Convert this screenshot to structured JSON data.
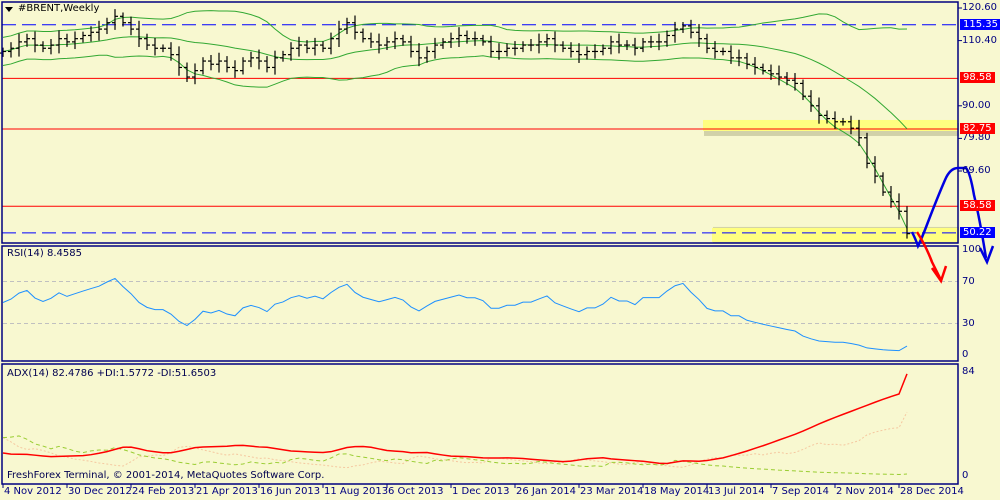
{
  "header": {
    "title": "#BRENT,Weekly",
    "menu_icon": "triangle-down-icon"
  },
  "indicators": {
    "rsi_label": "RSI(14) 8.4585",
    "adx_label": "ADX(14) 82.4786 +DI:1.5772 -DI:51.6503"
  },
  "footer": {
    "copyright": "FreshForex Terminal, © 2001-2014, MetaQuotes Software Corp."
  },
  "colors": {
    "background": "#f8f8d0",
    "axis": "#000080",
    "bands": "#32a832",
    "red_level": "#ff0000",
    "blue_level": "#0000ff",
    "zone": "#ffff80",
    "rsi": "#1e90ff",
    "adx": "#ff0000",
    "plus_di": "#9acd32",
    "minus_di": "#f5c8a0"
  },
  "chart_data": {
    "type": "bar",
    "title": "#BRENT,Weekly",
    "x_labels": [
      "4 Nov 2012",
      "30 Dec 2012",
      "24 Feb 2013",
      "21 Apr 2013",
      "16 Jun 2013",
      "11 Aug 2013",
      "6 Oct 2013",
      "1 Dec 2013",
      "26 Jan 2014",
      "23 Mar 2014",
      "18 May 2014",
      "13 Jul 2014",
      "7 Sep 2014",
      "2 Nov 2014",
      "28 Dec 2014"
    ],
    "weeks_per_label": 8,
    "closes": [
      107,
      108,
      110,
      111,
      109,
      108,
      109,
      111,
      110,
      111,
      112,
      113,
      114,
      116,
      118,
      116,
      114,
      111,
      109,
      108,
      108,
      106,
      102,
      99,
      101,
      104,
      103,
      104,
      102,
      101,
      104,
      105,
      104,
      102,
      105,
      106,
      108,
      109,
      108,
      109,
      108,
      111,
      114,
      116,
      113,
      111,
      110,
      109,
      110,
      111,
      110,
      107,
      105,
      107,
      109,
      110,
      111,
      112,
      111,
      111,
      110,
      107,
      107,
      108,
      108,
      109,
      109,
      110,
      111,
      109,
      108,
      107,
      106,
      107,
      107,
      108,
      110,
      109,
      109,
      108,
      110,
      110,
      110,
      112,
      114,
      115,
      113,
      111,
      108,
      107,
      107,
      105,
      105,
      103,
      102,
      101,
      100,
      99,
      98,
      97,
      93,
      90,
      87,
      86,
      85,
      85,
      83,
      80,
      72,
      68,
      63,
      60,
      57,
      50
    ],
    "price_ticks": [
      "120.60",
      "110.40",
      "90.00",
      "79.80",
      "69.60"
    ],
    "price_range": [
      48.5,
      122
    ],
    "levels": [
      {
        "value": 115.35,
        "label": "115.35",
        "color": "#0000ff",
        "style": "dashed"
      },
      {
        "value": 98.58,
        "label": "98.58",
        "color": "#ff0000",
        "style": "solid"
      },
      {
        "value": 82.75,
        "label": "82.75",
        "color": "#ff0000",
        "style": "solid"
      },
      {
        "value": 58.58,
        "label": "58.58",
        "color": "#ff0000",
        "style": "solid"
      },
      {
        "value": 50.22,
        "label": "50.22",
        "color": "#0000ff",
        "style": "dashed"
      }
    ],
    "zones": [
      {
        "around": 82.75
      },
      {
        "around": 50.22
      }
    ],
    "rsi": {
      "period": 14,
      "ticks": [
        "100",
        "70",
        "30",
        "0"
      ],
      "levels": [
        70,
        30
      ],
      "last": 8.4585
    },
    "adx": {
      "period": 14,
      "ticks": [
        "84",
        "0"
      ],
      "last_adx": 82.4786,
      "last_plus_di": 1.5772,
      "last_minus_di": 51.6503
    },
    "bollinger": {
      "period": 20,
      "deviations": 2
    }
  }
}
